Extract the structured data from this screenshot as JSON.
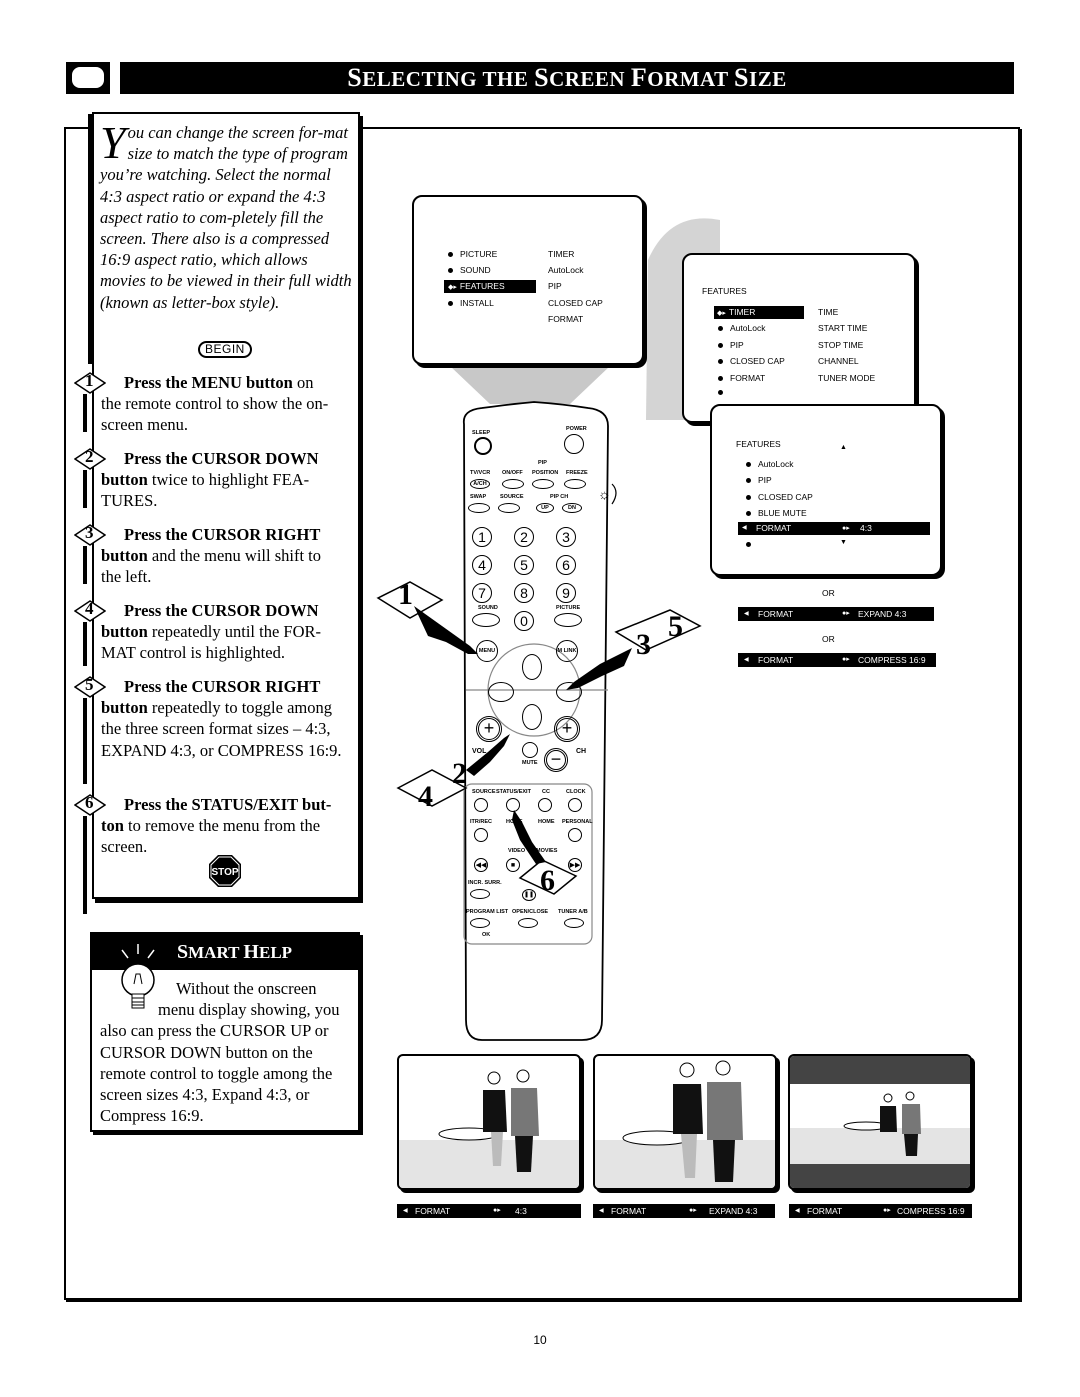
{
  "header": {
    "icon": "tv-icon",
    "title_parts": [
      {
        "cap": "S",
        "rest": "ELECTING THE "
      },
      {
        "cap": "S",
        "rest": "CREEN "
      },
      {
        "cap": "F",
        "rest": "ORMAT "
      },
      {
        "cap": "S",
        "rest": "IZE"
      }
    ]
  },
  "intro": {
    "dropcap": "Y",
    "text": "ou can change the screen for-mat size to match the type of program you’re watching. Select the normal 4:3 aspect ratio or expand the 4:3 aspect ratio to com-pletely fill the screen. There also is a compressed 16:9 aspect ratio, which allows movies to be viewed in their full width (known as letter-box style).",
    "begin": "BEGIN"
  },
  "steps": [
    {
      "num": "1",
      "head": "Press the MENU button",
      "head_tail": " on",
      "body": "the remote control to show the on-screen menu."
    },
    {
      "num": "2",
      "head": "Press the CURSOR DOWN",
      "body_bold": "button",
      "body": " twice to highlight FEA-TURES."
    },
    {
      "num": "3",
      "head": "Press the CURSOR RIGHT",
      "body_bold": "button",
      "body": " and the menu will shift to the left."
    },
    {
      "num": "4",
      "head": "Press the CURSOR DOWN",
      "body_bold": "button",
      "body": " repeatedly until the FOR-MAT control is highlighted."
    },
    {
      "num": "5",
      "head": "Press the CURSOR RIGHT",
      "body_bold": "button",
      "body": " repeatedly to toggle among the three screen format sizes – 4:3, EXPAND 4:3, or COMPRESS 16:9."
    },
    {
      "num": "6",
      "head": "Press the STATUS/EXIT but-",
      "body_bold": "ton",
      "body": " to remove the menu from the screen."
    }
  ],
  "stop_label": "STOP",
  "smart_help": {
    "title_cap1": "S",
    "title_rest1": "MART ",
    "title_cap2": "H",
    "title_rest2": "ELP",
    "line1": "Without the onscreen",
    "line2": "menu display showing, you",
    "rest": "also can press the CURSOR UP or CURSOR DOWN button on the remote control to toggle among the screen sizes 4:3, Expand 4:3, or Compress 16:9."
  },
  "menu_main": {
    "left": [
      "PICTURE",
      "SOUND",
      "FEATURES",
      "INSTALL"
    ],
    "selected": "FEATURES",
    "right": [
      "TIMER",
      "AutoLock",
      "PIP",
      "CLOSED  CAP",
      "FORMAT"
    ]
  },
  "menu_features": {
    "title": "FEATURES",
    "left": [
      "TIMER",
      "AutoLock",
      "PIP",
      "CLOSED  CAP",
      "FORMAT",
      ""
    ],
    "selected": "TIMER",
    "right": [
      "TIME",
      "START  TIME",
      "STOP  TIME",
      "CHANNEL",
      "TUNER  MODE"
    ]
  },
  "menu_format": {
    "title": "FEATURES",
    "items": [
      "AutoLock",
      "PIP",
      "CLOSED  CAP",
      "BLUE  MUTE"
    ],
    "selected_label": "FORMAT",
    "selected_value": "4:3"
  },
  "alternatives": [
    {
      "or": "OR",
      "label": "FORMAT",
      "value": "EXPAND  4:3"
    },
    {
      "or": "OR",
      "label": "FORMAT",
      "value": "COMPRESS  16:9"
    }
  ],
  "remote": {
    "sleep": "SLEEP",
    "power": "POWER",
    "pip": "PIP",
    "row1": [
      "TV/VCR",
      "ON/OFF",
      "POSITION",
      "FREEZE"
    ],
    "av": "A/CH",
    "row2": [
      "SWAP",
      "SOURCE",
      "PIP CH"
    ],
    "up": "UP",
    "dn": "DN",
    "digits": [
      "1",
      "2",
      "3",
      "4",
      "5",
      "6",
      "7",
      "8",
      "9",
      "0"
    ],
    "sound": "SOUND",
    "picture": "PICTURE",
    "menu": "MENU",
    "mlink": "M LINK",
    "vol": "VOL",
    "ch": "CH",
    "mute": "MUTE",
    "row3": [
      "SOURCE",
      "STATUS/EXIT",
      "CC",
      "CLOCK"
    ],
    "row4": [
      "ITR/REC",
      "HOME",
      "HOME",
      "PERSONAL"
    ],
    "row5": [
      "VIDEO",
      "MOVIES"
    ],
    "incr": "INCR. SURR.",
    "row6": [
      "PROGRAM LIST",
      "OPEN/CLOSE",
      "TUNER A/B"
    ],
    "ok": "OK"
  },
  "step_tags": [
    "1",
    "2",
    "3",
    "4",
    "5",
    "6"
  ],
  "pictures": [
    {
      "label": "FORMAT",
      "value": "4:3",
      "mode": "normal"
    },
    {
      "label": "FORMAT",
      "value": "EXPAND  4:3",
      "mode": "expand"
    },
    {
      "label": "FORMAT",
      "value": "COMPRESS  16:9",
      "mode": "compress"
    }
  ],
  "page_number": "10"
}
